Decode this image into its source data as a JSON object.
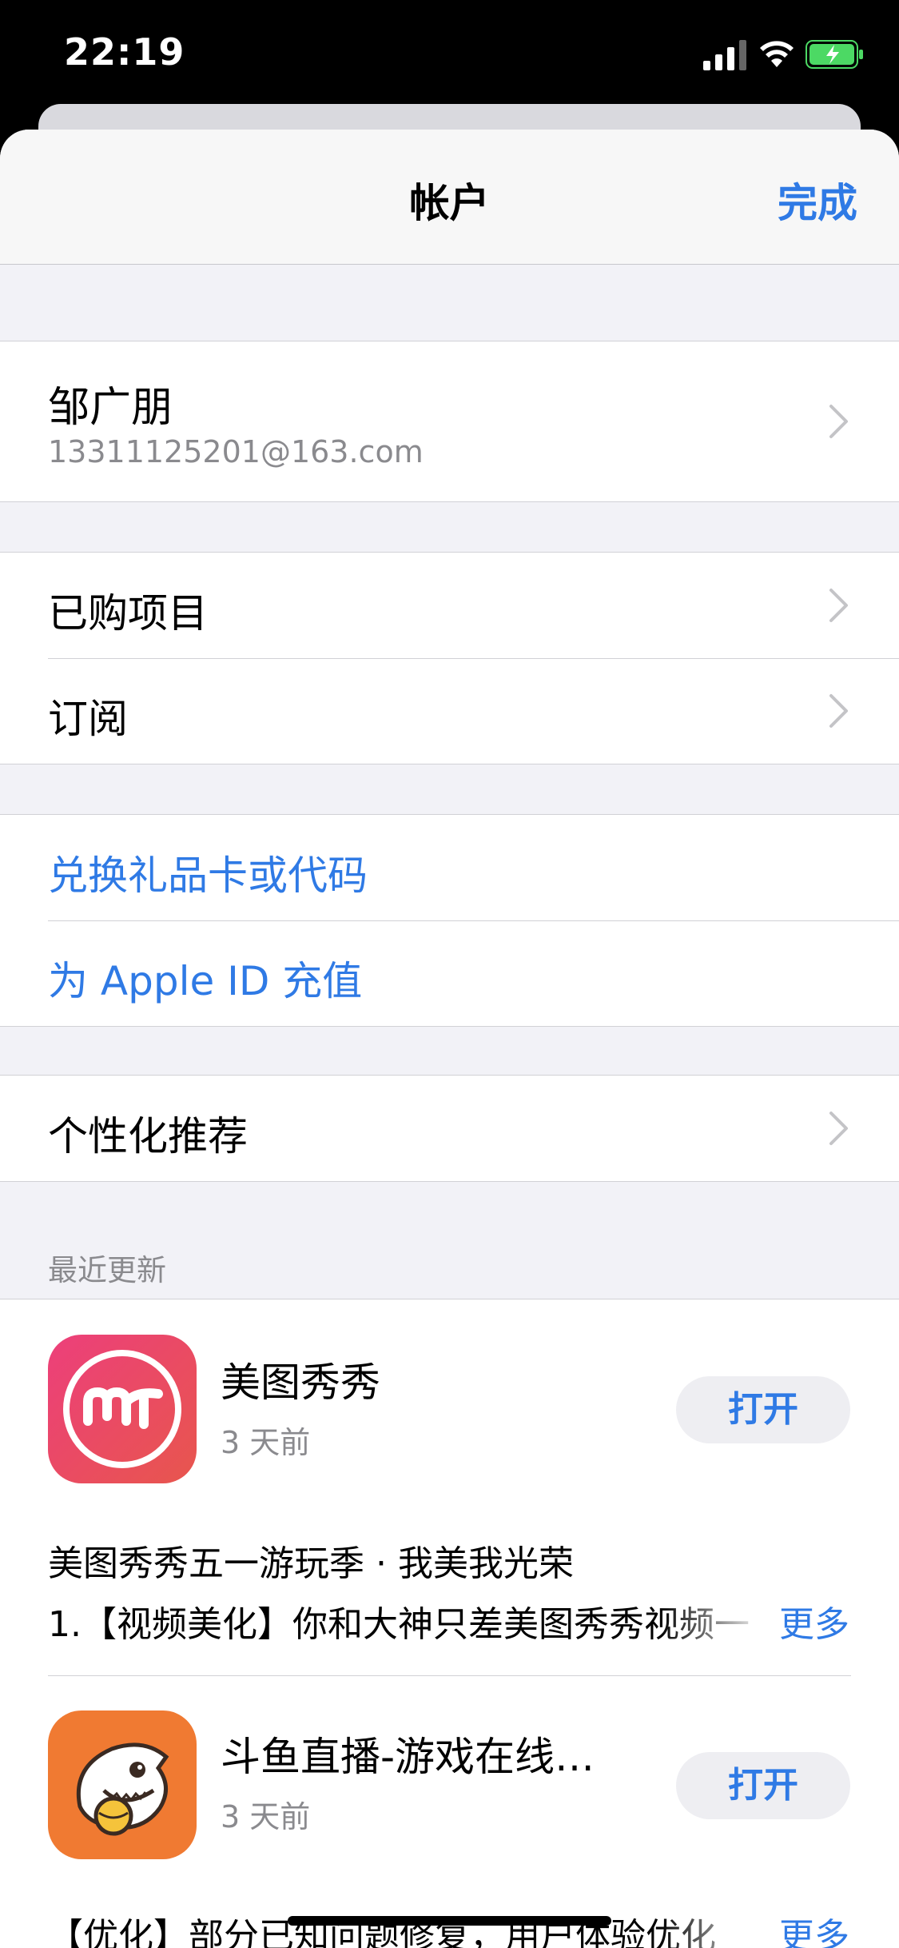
{
  "status_bar": {
    "time": "22:19"
  },
  "nav": {
    "title": "帐户",
    "done_label": "完成"
  },
  "account": {
    "name": "邹广朋",
    "email": "13311125201@163.com"
  },
  "group1": {
    "purchased": "已购项目",
    "subscriptions": "订阅"
  },
  "group2": {
    "redeem": "兑换礼品卡或代码",
    "add_funds": "为 Apple ID 充值"
  },
  "group3": {
    "personalized": "个性化推荐"
  },
  "recent_updates": {
    "header": "最近更新",
    "apps": [
      {
        "name": "美图秀秀",
        "date": "3 天前",
        "button": "打开",
        "notes_title": "美图秀秀五一游玩季 · 我美我光荣",
        "notes_line": "1.【视频美化】你和大神只差美图秀秀视频一",
        "more": "更多"
      },
      {
        "name": "斗鱼直播-游戏在线…",
        "date": "3 天前",
        "button": "打开",
        "notes_line": "【优化】部分已知问题修复，用户体验优化",
        "more": "更多"
      }
    ]
  },
  "colors": {
    "accent": "#2f7ae5",
    "meitu": "#e83e6c",
    "douyu": "#f07a32"
  }
}
